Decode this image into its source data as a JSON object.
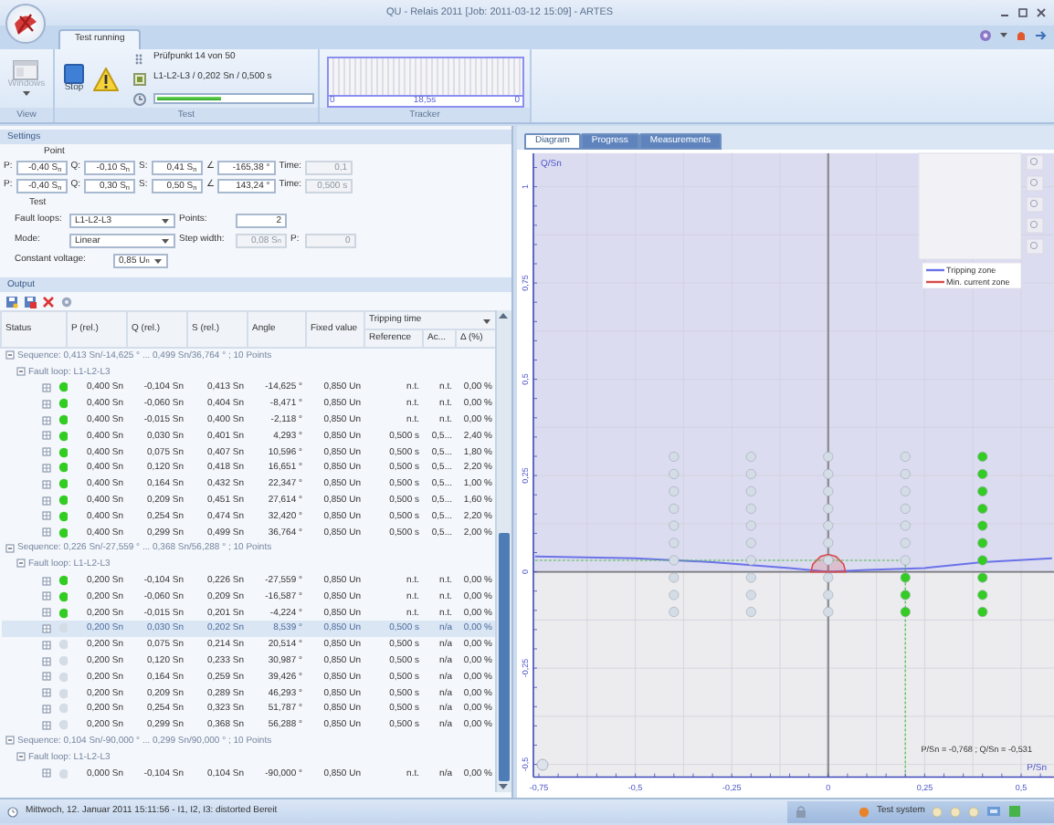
{
  "window": {
    "title": "QU - Relais 2011 [Job: 2011-03-12 15:09] - ARTES"
  },
  "ribbon_tabs": [
    {
      "label": "Test running",
      "selected": true
    }
  ],
  "ribbon": {
    "view": {
      "label": "View",
      "button": "Windows",
      "disabled": true
    },
    "test": {
      "label": "Test",
      "stop": "Stop",
      "lines": [
        "Prüfpunkt 14 von 50",
        "L1-L2-L3 / 0,202 Sn / 0,500 s"
      ],
      "progress": {
        "level": 0.42
      }
    },
    "tracker": {
      "label": "Tracker",
      "start": "0",
      "time": "18,5s",
      "end": "0"
    }
  },
  "settings": {
    "title": "Settings",
    "point_label": "Point",
    "point_rows": [
      [
        {
          "label": "P:",
          "value": "-0,40 S$_{n}$",
          "disabled": false
        },
        {
          "label": "Q:",
          "value": "-0,10 S$_{n}$",
          "disabled": false
        },
        {
          "label": "S:",
          "value": "0,41 S$_{n}$",
          "disabled": false
        },
        {
          "label": "∠",
          "value": "-165,38 °",
          "disabled": false
        },
        {
          "label": "Time:",
          "value": "0,1",
          "disabled": true
        }
      ],
      [
        {
          "label": "P:",
          "value": "-0,40 S$_{n}$",
          "disabled": false
        },
        {
          "label": "Q:",
          "value": "0,30 S$_{n}$",
          "disabled": false
        },
        {
          "label": "S:",
          "value": "0,50 S$_{n}$",
          "disabled": false
        },
        {
          "label": "∠",
          "value": "143,24 °",
          "disabled": false
        },
        {
          "label": "Time:",
          "value": "0,500 s",
          "disabled": true
        }
      ]
    ],
    "test_label": "Test",
    "test_rows": [
      [
        {
          "kind": "dropdown",
          "label": "Fault loops:",
          "value": "L1-L2-L3",
          "disabled": false
        },
        {
          "kind": "input",
          "label": "Points:",
          "value": "2",
          "disabled": false
        }
      ],
      [
        {
          "kind": "dropdown",
          "label": "Mode:",
          "value": "Linear",
          "disabled": false
        },
        {
          "kind": "input",
          "label": "Step width:",
          "value": "0,08 S$_{n}$",
          "disabled": true
        },
        {
          "kind": "input",
          "label": "P:",
          "value": "0",
          "disabled": true
        }
      ],
      [
        {
          "kind": "dropdown",
          "label": "Constant voltage:",
          "value": "0,85 U$_{n}$",
          "disabled": false
        }
      ]
    ]
  },
  "output": {
    "title": "Output",
    "columns": [
      "Status",
      "P (rel.)",
      "Q (rel.)",
      "S (rel.)",
      "Angle",
      "Fixed value"
    ],
    "tripping_time": {
      "label": "Tripping time",
      "columns": [
        "Reference",
        "Ac...",
        "Δ (%)"
      ]
    },
    "sequences": [
      {
        "label": "Sequence: 0,413 Sn/-14,625 ° ... 0,499 Sn/36,764 ° ; 10 Points",
        "expanded": true,
        "fault_loops": [
          {
            "label": "Fault loop: L1-L2-L3",
            "expanded": true,
            "rows": [
              {
                "p": "0,400 Sn",
                "q": "-0,104 Sn",
                "s": "0,413 Sn",
                "angle": "-14,625 °",
                "fixed": "0,850 Un",
                "reference": "n.t.",
                "ac": "n.t.",
                "delta": "0,00 %",
                "color": "#33cc22",
                "selected": false
              },
              {
                "p": "0,400 Sn",
                "q": "-0,060 Sn",
                "s": "0,404 Sn",
                "angle": "-8,471 °",
                "fixed": "0,850 Un",
                "reference": "n.t.",
                "ac": "n.t.",
                "delta": "0,00 %",
                "color": "#33cc22",
                "selected": false
              },
              {
                "p": "0,400 Sn",
                "q": "-0,015 Sn",
                "s": "0,400 Sn",
                "angle": "-2,118 °",
                "fixed": "0,850 Un",
                "reference": "n.t.",
                "ac": "n.t.",
                "delta": "0,00 %",
                "color": "#33cc22",
                "selected": false
              },
              {
                "p": "0,400 Sn",
                "q": "0,030 Sn",
                "s": "0,401 Sn",
                "angle": "4,293 °",
                "fixed": "0,850 Un",
                "reference": "0,500 s",
                "ac": "0,5...",
                "delta": "2,40 %",
                "color": "#33cc22",
                "selected": false
              },
              {
                "p": "0,400 Sn",
                "q": "0,075 Sn",
                "s": "0,407 Sn",
                "angle": "10,596 °",
                "fixed": "0,850 Un",
                "reference": "0,500 s",
                "ac": "0,5...",
                "delta": "1,80 %",
                "color": "#33cc22",
                "selected": false
              },
              {
                "p": "0,400 Sn",
                "q": "0,120 Sn",
                "s": "0,418 Sn",
                "angle": "16,651 °",
                "fixed": "0,850 Un",
                "reference": "0,500 s",
                "ac": "0,5...",
                "delta": "2,20 %",
                "color": "#33cc22",
                "selected": false
              },
              {
                "p": "0,400 Sn",
                "q": "0,164 Sn",
                "s": "0,432 Sn",
                "angle": "22,347 °",
                "fixed": "0,850 Un",
                "reference": "0,500 s",
                "ac": "0,5...",
                "delta": "1,00 %",
                "color": "#33cc22",
                "selected": false
              },
              {
                "p": "0,400 Sn",
                "q": "0,209 Sn",
                "s": "0,451 Sn",
                "angle": "27,614 °",
                "fixed": "0,850 Un",
                "reference": "0,500 s",
                "ac": "0,5...",
                "delta": "1,60 %",
                "color": "#33cc22",
                "selected": false
              },
              {
                "p": "0,400 Sn",
                "q": "0,254 Sn",
                "s": "0,474 Sn",
                "angle": "32,420 °",
                "fixed": "0,850 Un",
                "reference": "0,500 s",
                "ac": "0,5...",
                "delta": "2,20 %",
                "color": "#33cc22",
                "selected": false
              },
              {
                "p": "0,400 Sn",
                "q": "0,299 Sn",
                "s": "0,499 Sn",
                "angle": "36,764 °",
                "fixed": "0,850 Un",
                "reference": "0,500 s",
                "ac": "0,5...",
                "delta": "2,00 %",
                "color": "#33cc22",
                "selected": false
              }
            ]
          }
        ]
      },
      {
        "label": "Sequence: 0,226 Sn/-27,559 ° ... 0,368 Sn/56,288 ° ; 10 Points",
        "expanded": true,
        "fault_loops": [
          {
            "label": "Fault loop: L1-L2-L3",
            "expanded": true,
            "rows": [
              {
                "p": "0,200 Sn",
                "q": "-0,104 Sn",
                "s": "0,226 Sn",
                "angle": "-27,559 °",
                "fixed": "0,850 Un",
                "reference": "n.t.",
                "ac": "n.t.",
                "delta": "0,00 %",
                "color": "#33cc22",
                "selected": false
              },
              {
                "p": "0,200 Sn",
                "q": "-0,060 Sn",
                "s": "0,209 Sn",
                "angle": "-16,587 °",
                "fixed": "0,850 Un",
                "reference": "n.t.",
                "ac": "n.t.",
                "delta": "0,00 %",
                "color": "#33cc22",
                "selected": false
              },
              {
                "p": "0,200 Sn",
                "q": "-0,015 Sn",
                "s": "0,201 Sn",
                "angle": "-4,224 °",
                "fixed": "0,850 Un",
                "reference": "n.t.",
                "ac": "n.t.",
                "delta": "0,00 %",
                "color": "#33cc22",
                "selected": false
              },
              {
                "p": "0,200 Sn",
                "q": "0,030 Sn",
                "s": "0,202 Sn",
                "angle": "8,539 °",
                "fixed": "0,850 Un",
                "reference": "0,500 s",
                "ac": "n/a",
                "delta": "0,00 %",
                "color": "#d4dce6",
                "selected": true
              },
              {
                "p": "0,200 Sn",
                "q": "0,075 Sn",
                "s": "0,214 Sn",
                "angle": "20,514 °",
                "fixed": "0,850 Un",
                "reference": "0,500 s",
                "ac": "n/a",
                "delta": "0,00 %",
                "color": "#d4dce6",
                "selected": false
              },
              {
                "p": "0,200 Sn",
                "q": "0,120 Sn",
                "s": "0,233 Sn",
                "angle": "30,987 °",
                "fixed": "0,850 Un",
                "reference": "0,500 s",
                "ac": "n/a",
                "delta": "0,00 %",
                "color": "#d4dce6",
                "selected": false
              },
              {
                "p": "0,200 Sn",
                "q": "0,164 Sn",
                "s": "0,259 Sn",
                "angle": "39,426 °",
                "fixed": "0,850 Un",
                "reference": "0,500 s",
                "ac": "n/a",
                "delta": "0,00 %",
                "color": "#d4dce6",
                "selected": false
              },
              {
                "p": "0,200 Sn",
                "q": "0,209 Sn",
                "s": "0,289 Sn",
                "angle": "46,293 °",
                "fixed": "0,850 Un",
                "reference": "0,500 s",
                "ac": "n/a",
                "delta": "0,00 %",
                "color": "#d4dce6",
                "selected": false
              },
              {
                "p": "0,200 Sn",
                "q": "0,254 Sn",
                "s": "0,323 Sn",
                "angle": "51,787 °",
                "fixed": "0,850 Un",
                "reference": "0,500 s",
                "ac": "n/a",
                "delta": "0,00 %",
                "color": "#d4dce6",
                "selected": false
              },
              {
                "p": "0,200 Sn",
                "q": "0,299 Sn",
                "s": "0,368 Sn",
                "angle": "56,288 °",
                "fixed": "0,850 Un",
                "reference": "0,500 s",
                "ac": "n/a",
                "delta": "0,00 %",
                "color": "#d4dce6",
                "selected": false
              }
            ]
          }
        ]
      },
      {
        "label": "Sequence: 0,104 Sn/-90,000 ° ... 0,299 Sn/90,000 ° ; 10 Points",
        "expanded": true,
        "fault_loops": [
          {
            "label": "Fault loop: L1-L2-L3",
            "expanded": true,
            "rows": [
              {
                "p": "0,000 Sn",
                "q": "-0,104 Sn",
                "s": "0,104 Sn",
                "angle": "-90,000 °",
                "fixed": "0,850 Un",
                "reference": "n.t.",
                "ac": "n/a",
                "delta": "0,00 %",
                "color": "#d4dce6",
                "selected": false
              }
            ]
          }
        ]
      }
    ]
  },
  "diagram": {
    "tabs": [
      {
        "label": "Diagram",
        "selected": true
      },
      {
        "label": "Progress",
        "selected": false
      },
      {
        "label": "Measurements",
        "selected": false
      }
    ],
    "readout": "P/Sn = -0,768 ; Q/Sn = -0,531",
    "chart_data": {
      "type": "scatter",
      "grid": true,
      "xlabel": "P/Sn",
      "ylabel": "Q/Sn",
      "xlim": [
        -0.764,
        0.585
      ],
      "ylim": [
        -0.533,
        1.087
      ],
      "xticks": [
        {
          "value": -0.75,
          "label": "-0,75"
        },
        {
          "value": -0.5,
          "label": "-0,5"
        },
        {
          "value": -0.25,
          "label": "-0,25"
        },
        {
          "value": 0,
          "label": "0"
        },
        {
          "value": 0.25,
          "label": "0,25"
        },
        {
          "value": 0.5,
          "label": "0,5"
        }
      ],
      "yticks": [
        {
          "value": 1,
          "label": "1"
        },
        {
          "value": 0.75,
          "label": "0,75"
        },
        {
          "value": 0.5,
          "label": "0,5"
        },
        {
          "value": 0.25,
          "label": "0,25"
        },
        {
          "value": 0,
          "label": "0"
        },
        {
          "value": -0.25,
          "label": "-0,25"
        },
        {
          "value": -0.5,
          "label": "-0,5"
        }
      ],
      "x": [
        -0.4,
        -0.4,
        -0.4,
        -0.4,
        -0.4,
        -0.4,
        -0.4,
        -0.4,
        -0.4,
        -0.4,
        -0.2,
        -0.2,
        -0.2,
        -0.2,
        -0.2,
        -0.2,
        -0.2,
        -0.2,
        -0.2,
        -0.2,
        0,
        0,
        0,
        0,
        0,
        0,
        0,
        0,
        0,
        0,
        0.2,
        0.2,
        0.2,
        0.2,
        0.2,
        0.2,
        0.2,
        0.2,
        0.2,
        0.2,
        0.4,
        0.4,
        0.4,
        0.4,
        0.4,
        0.4,
        0.4,
        0.4,
        0.4,
        0.4
      ],
      "series": [
        {
          "color": "#d4dce6",
          "values": [
            -0.104,
            -0.06,
            -0.015,
            0.03,
            0.075,
            0.12,
            0.164,
            0.209,
            0.254,
            0.299,
            -0.104,
            -0.06,
            -0.015,
            0.03,
            0.075,
            0.12,
            0.164,
            0.209,
            0.254,
            0.299,
            -0.104,
            -0.06,
            -0.015,
            0.03,
            0.075,
            0.12,
            0.164,
            0.209,
            0.254,
            0.299,
            null,
            null,
            null,
            0.03,
            0.075,
            0.12,
            0.164,
            0.209,
            0.254,
            0.299,
            null,
            null,
            null,
            null,
            null,
            null,
            null,
            null,
            null,
            null
          ]
        },
        {
          "color": "#33cc22",
          "values": [
            null,
            null,
            null,
            null,
            null,
            null,
            null,
            null,
            null,
            null,
            null,
            null,
            null,
            null,
            null,
            null,
            null,
            null,
            null,
            null,
            null,
            null,
            null,
            null,
            null,
            null,
            null,
            null,
            null,
            null,
            -0.104,
            -0.06,
            -0.015,
            null,
            null,
            null,
            null,
            null,
            null,
            null,
            -0.104,
            -0.06,
            -0.015,
            0.03,
            0.075,
            0.12,
            0.164,
            0.209,
            0.254,
            0.299
          ]
        },
        {
          "type": "line",
          "name": "Tripping zone",
          "color": "#6a72e8",
          "x": [
            -0.76,
            -0.5,
            -0.3,
            -0.1,
            0,
            0.1,
            0.25,
            0.4,
            0.58
          ],
          "values": [
            0.04,
            0.035,
            0.025,
            0.01,
            0,
            0.005,
            0.01,
            0.025,
            0.035
          ]
        },
        {
          "type": "area",
          "name": "Min. current zone",
          "color": "#d84a4a",
          "x": [
            -0.045,
            -0.04,
            -0.02,
            0,
            0.02,
            0.04,
            0.045
          ],
          "values": [
            0,
            0.02,
            0.04,
            0.045,
            0.04,
            0.02,
            0
          ]
        },
        {
          "type": "line",
          "line_style": "dashed",
          "color": "#4cb84c",
          "x": [
            -0.76,
            0.2,
            0.2
          ],
          "values": [
            0.03,
            0.03,
            -0.53
          ]
        }
      ],
      "legend": "upper right",
      "bands": [
        {
          "axis": "y",
          "from": 0,
          "to": 1.087,
          "color": "#dcdcf0"
        }
      ]
    }
  },
  "status_bar": {
    "text": "Mittwoch, 12. Januar 2011 15:11:56 - I1, I2, I3: distorted Bereit",
    "tray": "Test system"
  }
}
